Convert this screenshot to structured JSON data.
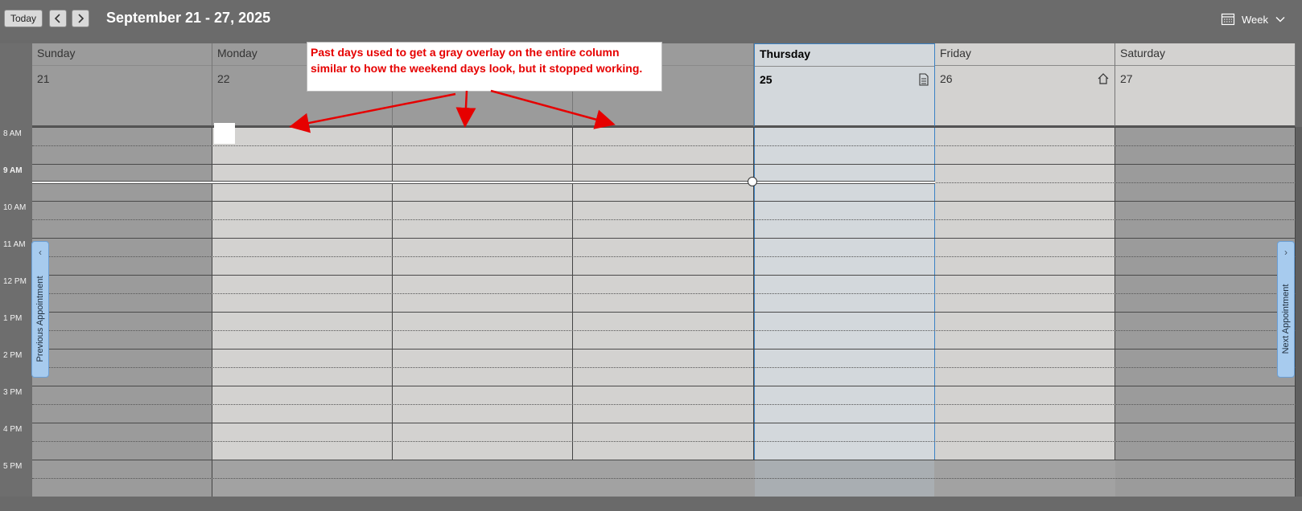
{
  "toolbar": {
    "today_label": "Today",
    "prev_label": "<",
    "next_label": ">",
    "date_range": "September 21 - 27, 2025",
    "view_label": "Week"
  },
  "days": [
    {
      "name": "Sunday",
      "num": "21"
    },
    {
      "name": "Monday",
      "num": "22"
    },
    {
      "name": "",
      "num": ""
    },
    {
      "name": "",
      "num": ""
    },
    {
      "name": "Thursday",
      "num": "25"
    },
    {
      "name": "Friday",
      "num": "26"
    },
    {
      "name": "Saturday",
      "num": "27"
    }
  ],
  "times": [
    "8 AM",
    "9 AM",
    "10 AM",
    "11 AM",
    "12 PM",
    "1 PM",
    "2 PM",
    "3 PM",
    "4 PM",
    "5 PM"
  ],
  "nav": {
    "previous_label": "Previous Appointment",
    "next_label": "Next Appointment",
    "previous_arrow": "‹",
    "next_arrow": "›"
  },
  "annotation": {
    "text": "Past days used to get a gray overlay on the entire column similar to how the weekend days look, but it stopped working."
  },
  "colors": {
    "weekend_bg": "#9b9b9b",
    "weekday_bg": "#d3d2d0",
    "today_bg": "#d3d8dc",
    "accent_border": "#3b82c4",
    "annotation_text": "#e60000"
  }
}
